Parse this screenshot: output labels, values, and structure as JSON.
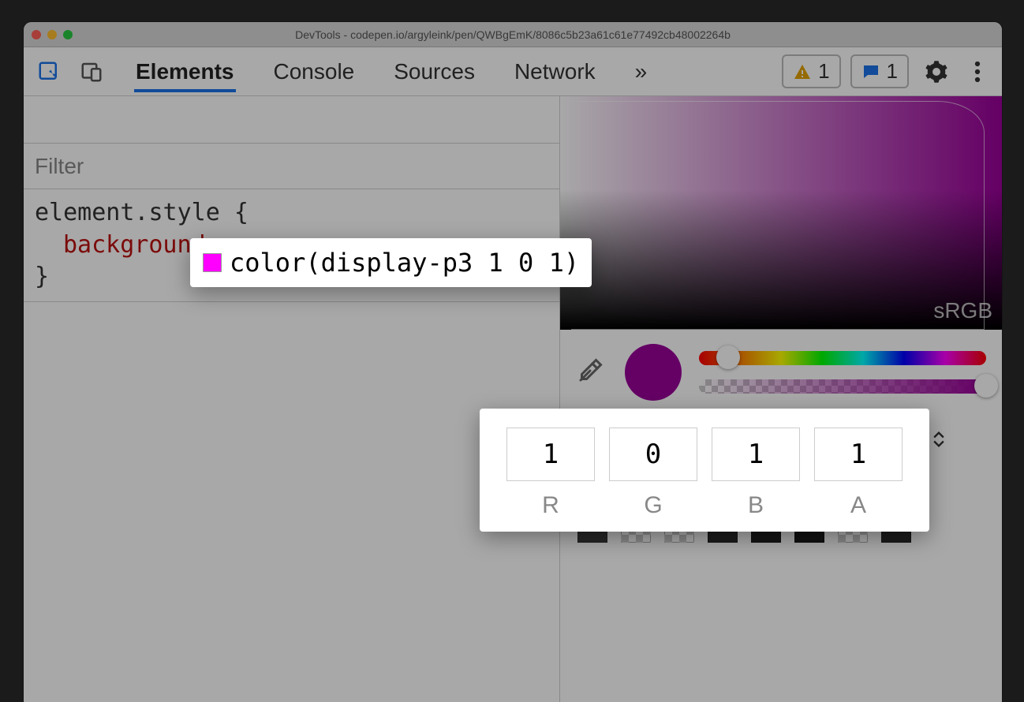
{
  "window": {
    "title": "DevTools - codepen.io/argyleink/pen/QWBgEmK/8086c5b23a61c61e77492cb48002264b"
  },
  "toolbar": {
    "tabs": [
      "Elements",
      "Console",
      "Sources",
      "Network"
    ],
    "active_tab": 0,
    "more_tabs_glyph": "»",
    "warnings_count": "1",
    "messages_count": "1"
  },
  "styles": {
    "filter_placeholder": "Filter",
    "selector": "element.style {",
    "property_name": "background",
    "property_value": "color(display-p3 1 0 1)",
    "close_brace": "}"
  },
  "picker": {
    "gamut_label": "sRGB",
    "hue_thumb_pct": 6,
    "alpha_thumb_pct": 98,
    "current_color": "#9a009a",
    "swatch_color": "#ff00ff",
    "channels": [
      {
        "label": "R",
        "value": "1"
      },
      {
        "label": "G",
        "value": "0"
      },
      {
        "label": "B",
        "value": "1"
      },
      {
        "label": "A",
        "value": "1"
      }
    ],
    "palette": [
      [
        "#8a87d6",
        "#000000",
        "#2d2d2d",
        "#d6c400",
        "#c9a400",
        "#ffffff",
        "#ffffff",
        "#9e9e9e"
      ],
      [
        "#9e9e9e",
        "#5a5a5a",
        "#494949",
        "#3a3a3a",
        "#checker",
        "#checker",
        "#000000",
        "#checker"
      ],
      [
        "#3a3a3a",
        "#checker",
        "#checker",
        "#2a2a2a",
        "#1f1f1f",
        "#1a1a1a",
        "#checker",
        "#2a2a2a"
      ]
    ]
  }
}
